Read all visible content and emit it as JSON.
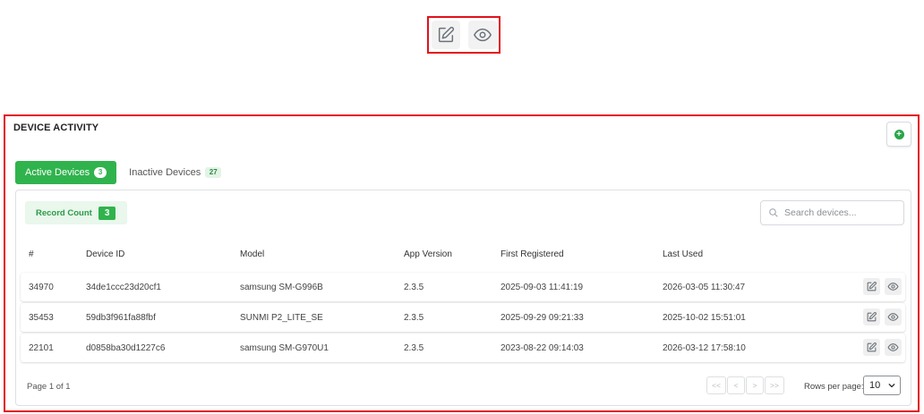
{
  "callout": {
    "edit_icon": "pencil-square-icon",
    "view_icon": "eye-icon"
  },
  "card": {
    "title": "DEVICE ACTIVITY",
    "add_icon": "plus-circle-icon",
    "accent": "#30b34d",
    "highlight": "#e3121b"
  },
  "tabs": [
    {
      "label": "Active Devices",
      "count": "3"
    },
    {
      "label": "Inactive Devices",
      "count": "27"
    }
  ],
  "record_count": {
    "label": "Record Count",
    "value": "3"
  },
  "search": {
    "placeholder": "Search devices..."
  },
  "table": {
    "columns": [
      "#",
      "Device ID",
      "Model",
      "App Version",
      "First Registered",
      "Last Used"
    ],
    "rows": [
      {
        "id": "34970",
        "device_id": "34de1ccc23d20cf1",
        "model": "samsung SM-G996B",
        "app_version": "2.3.5",
        "first_registered": "2025-09-03 11:41:19",
        "last_used": "2026-03-05 11:30:47"
      },
      {
        "id": "35453",
        "device_id": "59db3f961fa88fbf",
        "model": "SUNMI P2_LITE_SE",
        "app_version": "2.3.5",
        "first_registered": "2025-09-29 09:21:33",
        "last_used": "2025-10-02 15:51:01"
      },
      {
        "id": "22101",
        "device_id": "d0858ba30d1227c6",
        "model": "samsung SM-G970U1",
        "app_version": "2.3.5",
        "first_registered": "2023-08-22 09:14:03",
        "last_used": "2026-03-12 17:58:10"
      }
    ]
  },
  "footer": {
    "page_info": "Page 1 of 1",
    "pager": {
      "first": "<<",
      "prev": "<",
      "next": ">",
      "last": ">>"
    },
    "rows_per_page_label": "Rows per page:",
    "rows_per_page_value": "10"
  }
}
